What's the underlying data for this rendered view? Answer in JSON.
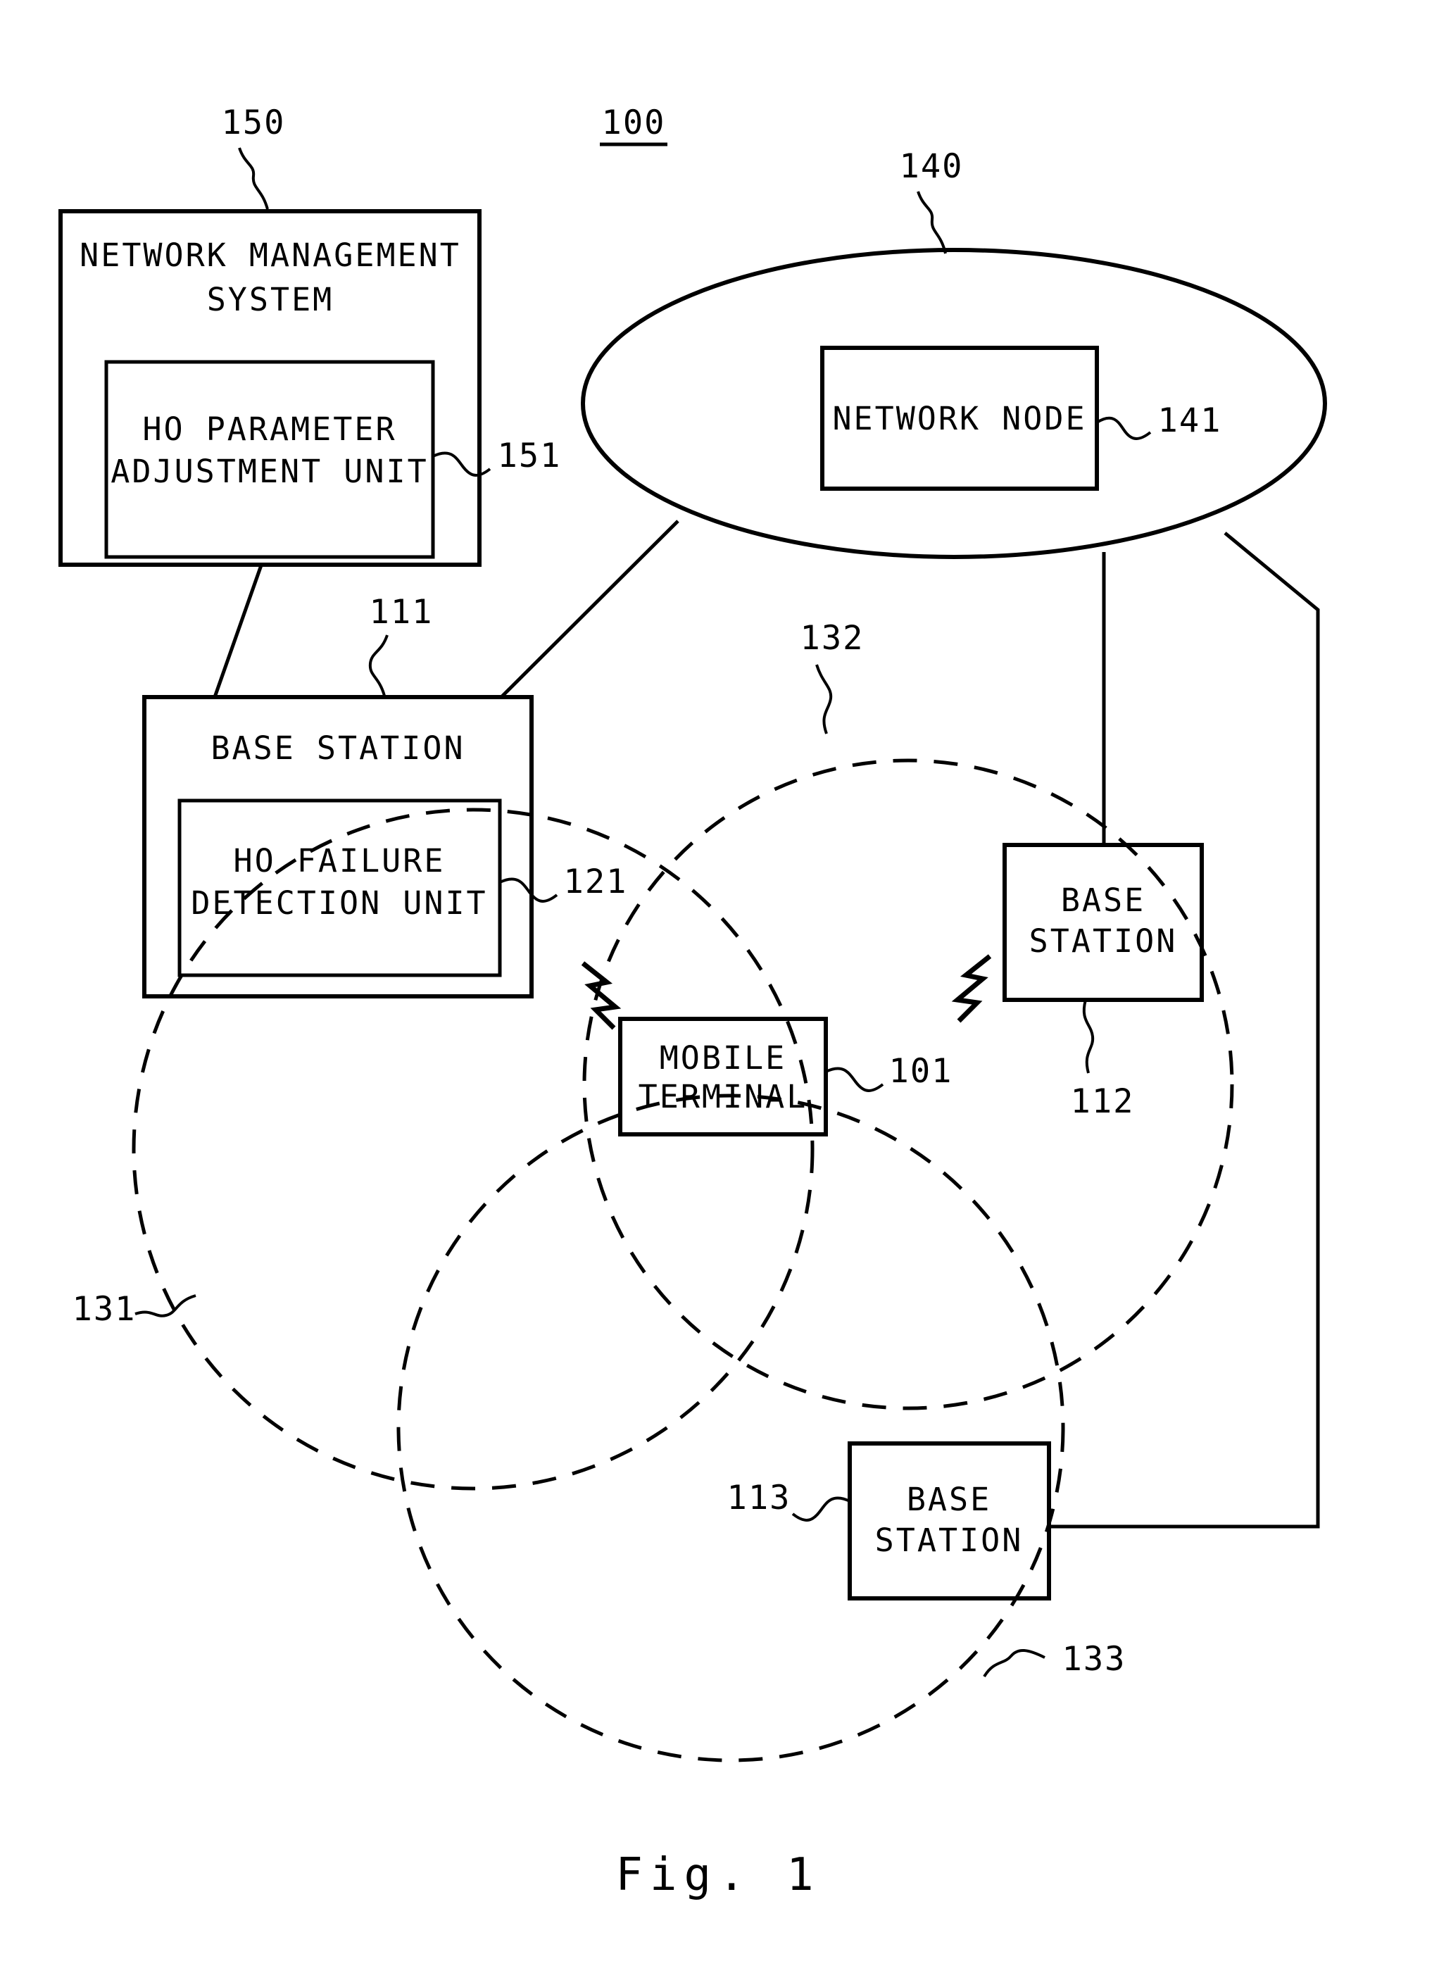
{
  "figure": {
    "caption": "Fig. 1",
    "system_ref": "100"
  },
  "blocks": {
    "network_management_system": {
      "ref": "150",
      "line1": "NETWORK MANAGEMENT",
      "line2": "SYSTEM"
    },
    "ho_parameter_adjustment_unit": {
      "ref": "151",
      "line1": "HO PARAMETER",
      "line2": "ADJUSTMENT UNIT"
    },
    "core_network": {
      "ref": "140"
    },
    "network_node": {
      "ref": "141",
      "label": "NETWORK NODE"
    },
    "base_station_111": {
      "ref": "111",
      "label": "BASE STATION"
    },
    "ho_failure_detection_unit": {
      "ref": "121",
      "line1": "HO FAILURE",
      "line2": "DETECTION UNIT"
    },
    "mobile_terminal": {
      "ref": "101",
      "line1": "MOBILE",
      "line2": "TERMINAL"
    },
    "base_station_112": {
      "ref": "112",
      "line1": "BASE",
      "line2": "STATION"
    },
    "base_station_113": {
      "ref": "113",
      "line1": "BASE",
      "line2": "STATION"
    }
  },
  "cells": {
    "cell_131": {
      "ref": "131"
    },
    "cell_132": {
      "ref": "132"
    },
    "cell_133": {
      "ref": "133"
    }
  },
  "colors": {
    "ink": "#000000",
    "paper": "#ffffff"
  }
}
